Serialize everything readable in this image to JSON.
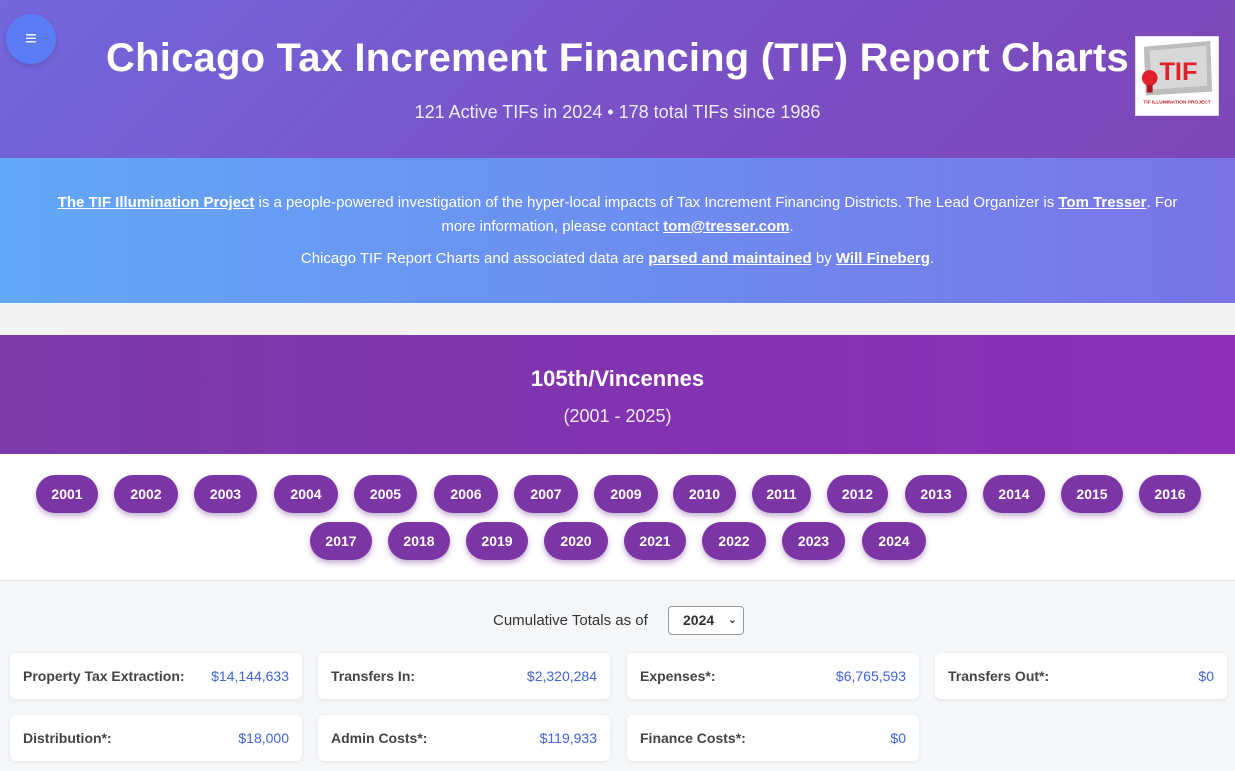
{
  "header": {
    "menu_icon": "≡",
    "title": "Chicago Tax Increment Financing (TIF) Report Charts",
    "subtitle": "121 Active TIFs in 2024 • 178 total TIFs since 1986",
    "logo": {
      "text": "TIF",
      "caption": "TIF ILLUMINATION PROJECT"
    }
  },
  "info": {
    "line1": {
      "link1": "The TIF Illumination Project",
      "text1": " is a people-powered investigation of the hyper-local impacts of Tax Increment Financing Districts. The Lead Organizer is ",
      "link2": "Tom Tresser",
      "text2": ". For more information, please contact ",
      "link3": "tom@tresser.com",
      "text3": "."
    },
    "line2": {
      "text1": "Chicago TIF Report Charts and associated data are ",
      "link1": "parsed and maintained",
      "text2": " by ",
      "link2": "Will Fineberg",
      "text3": "."
    }
  },
  "tif": {
    "name": "105th/Vincennes",
    "range": "(2001 - 2025)"
  },
  "years": [
    "2001",
    "2002",
    "2003",
    "2004",
    "2005",
    "2006",
    "2007",
    "2009",
    "2010",
    "2011",
    "2012",
    "2013",
    "2014",
    "2015",
    "2016",
    "2017",
    "2018",
    "2019",
    "2020",
    "2021",
    "2022",
    "2023",
    "2024"
  ],
  "cumulative": {
    "label": "Cumulative Totals as of",
    "selected_year": "2024"
  },
  "cards": [
    {
      "label": "Property Tax Extraction:",
      "value": "$14,144,633"
    },
    {
      "label": "Transfers In:",
      "value": "$2,320,284"
    },
    {
      "label": "Expenses*:",
      "value": "$6,765,593"
    },
    {
      "label": "Transfers Out*:",
      "value": "$0"
    },
    {
      "label": "Distribution*:",
      "value": "$18,000"
    },
    {
      "label": "Admin Costs*:",
      "value": "$119,933"
    },
    {
      "label": "Finance Costs*:",
      "value": "$0"
    }
  ]
}
